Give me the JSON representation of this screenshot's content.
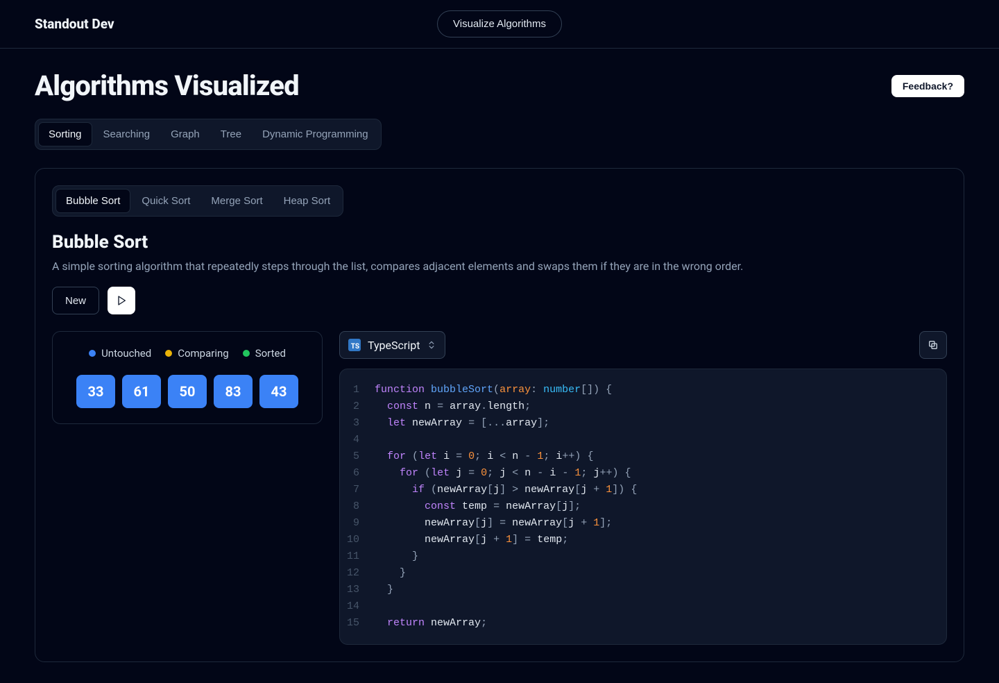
{
  "header": {
    "brand": "Standout Dev",
    "nav_button": "Visualize Algorithms"
  },
  "main": {
    "title": "Algorithms Visualized",
    "feedback_label": "Feedback?",
    "category_tabs": [
      "Sorting",
      "Searching",
      "Graph",
      "Tree",
      "Dynamic Programming"
    ],
    "active_category": "Sorting",
    "algo_tabs": [
      "Bubble Sort",
      "Quick Sort",
      "Merge Sort",
      "Heap Sort"
    ],
    "active_algo": "Bubble Sort",
    "section_title": "Bubble Sort",
    "section_desc": "A simple sorting algorithm that repeatedly steps through the list, compares adjacent elements and swaps them if they are in the wrong order.",
    "new_button": "New",
    "legend": {
      "untouched": {
        "label": "Untouched",
        "color": "#3b82f6"
      },
      "comparing": {
        "label": "Comparing",
        "color": "#eab308"
      },
      "sorted": {
        "label": "Sorted",
        "color": "#22c55e"
      }
    },
    "array": [
      33,
      61,
      50,
      83,
      43
    ],
    "language": "TypeScript",
    "code": [
      [
        [
          "kw",
          "function"
        ],
        [
          "sp",
          " "
        ],
        [
          "fn",
          "bubbleSort"
        ],
        [
          "punc",
          "("
        ],
        [
          "param",
          "array"
        ],
        [
          "punc",
          ":"
        ],
        [
          "sp",
          " "
        ],
        [
          "type",
          "number"
        ],
        [
          "punc",
          "[]"
        ],
        [
          "punc",
          ")"
        ],
        [
          "sp",
          " "
        ],
        [
          "punc",
          "{"
        ]
      ],
      [
        [
          "sp",
          "  "
        ],
        [
          "kw",
          "const"
        ],
        [
          "sp",
          " "
        ],
        [
          "ident",
          "n"
        ],
        [
          "sp",
          " "
        ],
        [
          "op",
          "="
        ],
        [
          "sp",
          " "
        ],
        [
          "ident",
          "array"
        ],
        [
          "punc",
          "."
        ],
        [
          "ident",
          "length"
        ],
        [
          "punc",
          ";"
        ]
      ],
      [
        [
          "sp",
          "  "
        ],
        [
          "kw",
          "let"
        ],
        [
          "sp",
          " "
        ],
        [
          "ident",
          "newArray"
        ],
        [
          "sp",
          " "
        ],
        [
          "op",
          "="
        ],
        [
          "sp",
          " "
        ],
        [
          "punc",
          "["
        ],
        [
          "op",
          "..."
        ],
        [
          "ident",
          "array"
        ],
        [
          "punc",
          "]"
        ],
        [
          "punc",
          ";"
        ]
      ],
      [],
      [
        [
          "sp",
          "  "
        ],
        [
          "kw",
          "for"
        ],
        [
          "sp",
          " "
        ],
        [
          "punc",
          "("
        ],
        [
          "kw",
          "let"
        ],
        [
          "sp",
          " "
        ],
        [
          "ident",
          "i"
        ],
        [
          "sp",
          " "
        ],
        [
          "op",
          "="
        ],
        [
          "sp",
          " "
        ],
        [
          "num",
          "0"
        ],
        [
          "punc",
          ";"
        ],
        [
          "sp",
          " "
        ],
        [
          "ident",
          "i"
        ],
        [
          "sp",
          " "
        ],
        [
          "op",
          "<"
        ],
        [
          "sp",
          " "
        ],
        [
          "ident",
          "n"
        ],
        [
          "sp",
          " "
        ],
        [
          "op",
          "-"
        ],
        [
          "sp",
          " "
        ],
        [
          "num",
          "1"
        ],
        [
          "punc",
          ";"
        ],
        [
          "sp",
          " "
        ],
        [
          "ident",
          "i"
        ],
        [
          "op",
          "++"
        ],
        [
          "punc",
          ")"
        ],
        [
          "sp",
          " "
        ],
        [
          "punc",
          "{"
        ]
      ],
      [
        [
          "sp",
          "    "
        ],
        [
          "kw",
          "for"
        ],
        [
          "sp",
          " "
        ],
        [
          "punc",
          "("
        ],
        [
          "kw",
          "let"
        ],
        [
          "sp",
          " "
        ],
        [
          "ident",
          "j"
        ],
        [
          "sp",
          " "
        ],
        [
          "op",
          "="
        ],
        [
          "sp",
          " "
        ],
        [
          "num",
          "0"
        ],
        [
          "punc",
          ";"
        ],
        [
          "sp",
          " "
        ],
        [
          "ident",
          "j"
        ],
        [
          "sp",
          " "
        ],
        [
          "op",
          "<"
        ],
        [
          "sp",
          " "
        ],
        [
          "ident",
          "n"
        ],
        [
          "sp",
          " "
        ],
        [
          "op",
          "-"
        ],
        [
          "sp",
          " "
        ],
        [
          "ident",
          "i"
        ],
        [
          "sp",
          " "
        ],
        [
          "op",
          "-"
        ],
        [
          "sp",
          " "
        ],
        [
          "num",
          "1"
        ],
        [
          "punc",
          ";"
        ],
        [
          "sp",
          " "
        ],
        [
          "ident",
          "j"
        ],
        [
          "op",
          "++"
        ],
        [
          "punc",
          ")"
        ],
        [
          "sp",
          " "
        ],
        [
          "punc",
          "{"
        ]
      ],
      [
        [
          "sp",
          "      "
        ],
        [
          "kw",
          "if"
        ],
        [
          "sp",
          " "
        ],
        [
          "punc",
          "("
        ],
        [
          "ident",
          "newArray"
        ],
        [
          "punc",
          "["
        ],
        [
          "ident",
          "j"
        ],
        [
          "punc",
          "]"
        ],
        [
          "sp",
          " "
        ],
        [
          "op",
          ">"
        ],
        [
          "sp",
          " "
        ],
        [
          "ident",
          "newArray"
        ],
        [
          "punc",
          "["
        ],
        [
          "ident",
          "j"
        ],
        [
          "sp",
          " "
        ],
        [
          "op",
          "+"
        ],
        [
          "sp",
          " "
        ],
        [
          "num",
          "1"
        ],
        [
          "punc",
          "]"
        ],
        [
          "punc",
          ")"
        ],
        [
          "sp",
          " "
        ],
        [
          "punc",
          "{"
        ]
      ],
      [
        [
          "sp",
          "        "
        ],
        [
          "kw",
          "const"
        ],
        [
          "sp",
          " "
        ],
        [
          "ident",
          "temp"
        ],
        [
          "sp",
          " "
        ],
        [
          "op",
          "="
        ],
        [
          "sp",
          " "
        ],
        [
          "ident",
          "newArray"
        ],
        [
          "punc",
          "["
        ],
        [
          "ident",
          "j"
        ],
        [
          "punc",
          "]"
        ],
        [
          "punc",
          ";"
        ]
      ],
      [
        [
          "sp",
          "        "
        ],
        [
          "ident",
          "newArray"
        ],
        [
          "punc",
          "["
        ],
        [
          "ident",
          "j"
        ],
        [
          "punc",
          "]"
        ],
        [
          "sp",
          " "
        ],
        [
          "op",
          "="
        ],
        [
          "sp",
          " "
        ],
        [
          "ident",
          "newArray"
        ],
        [
          "punc",
          "["
        ],
        [
          "ident",
          "j"
        ],
        [
          "sp",
          " "
        ],
        [
          "op",
          "+"
        ],
        [
          "sp",
          " "
        ],
        [
          "num",
          "1"
        ],
        [
          "punc",
          "]"
        ],
        [
          "punc",
          ";"
        ]
      ],
      [
        [
          "sp",
          "        "
        ],
        [
          "ident",
          "newArray"
        ],
        [
          "punc",
          "["
        ],
        [
          "ident",
          "j"
        ],
        [
          "sp",
          " "
        ],
        [
          "op",
          "+"
        ],
        [
          "sp",
          " "
        ],
        [
          "num",
          "1"
        ],
        [
          "punc",
          "]"
        ],
        [
          "sp",
          " "
        ],
        [
          "op",
          "="
        ],
        [
          "sp",
          " "
        ],
        [
          "ident",
          "temp"
        ],
        [
          "punc",
          ";"
        ]
      ],
      [
        [
          "sp",
          "      "
        ],
        [
          "punc",
          "}"
        ]
      ],
      [
        [
          "sp",
          "    "
        ],
        [
          "punc",
          "}"
        ]
      ],
      [
        [
          "sp",
          "  "
        ],
        [
          "punc",
          "}"
        ]
      ],
      [],
      [
        [
          "sp",
          "  "
        ],
        [
          "kw",
          "return"
        ],
        [
          "sp",
          " "
        ],
        [
          "ident",
          "newArray"
        ],
        [
          "punc",
          ";"
        ]
      ]
    ]
  }
}
